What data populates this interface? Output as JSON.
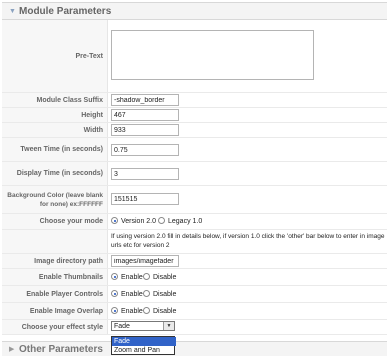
{
  "header": {
    "title": "Module Parameters",
    "expanded_icon": "▼"
  },
  "pretext": {
    "label": "Pre-Text",
    "value": ""
  },
  "module_class_suffix": {
    "label": "Module Class Suffix",
    "value": "-shadow_border"
  },
  "height": {
    "label": "Height",
    "value": "467"
  },
  "width": {
    "label": "Width",
    "value": "933"
  },
  "tween_time": {
    "label": "Tween Time (in seconds)",
    "value": "0.75"
  },
  "display_time": {
    "label": "Display Time (in seconds)",
    "value": "3"
  },
  "background_color": {
    "label": "Background Color (leave blank for none) ex:FFFFFF",
    "value": "151515"
  },
  "mode": {
    "label": "Choose your mode",
    "options": [
      "Version 2.0",
      "Legacy 1.0"
    ],
    "selected": "Version 2.0",
    "info": "If using version 2.0 fill in details below, if version 1.0 click the 'other' bar below to enter in image urls etc for version 2"
  },
  "image_directory": {
    "label": "Image directory path",
    "value": "images/imagefader"
  },
  "thumbnails": {
    "label": "Enable Thumbnails",
    "options": [
      "Enable",
      "Disable"
    ],
    "selected": "Enable"
  },
  "player_controls": {
    "label": "Enable Player Controls",
    "options": [
      "Enable",
      "Disable"
    ],
    "selected": "Enable"
  },
  "image_overlap": {
    "label": "Enable Image Overlap",
    "options": [
      "Enable",
      "Disable"
    ],
    "selected": "Enable"
  },
  "effect_style": {
    "label": "Choose your effect style",
    "value": "Fade",
    "options": [
      "Fade",
      "Zoom and Pan"
    ],
    "highlighted": "Fade"
  },
  "footer": {
    "title": "Other Parameters",
    "collapsed_icon": "▶"
  },
  "colors": {
    "header_bg": "#f4f4f4",
    "label_bg": "#f7f7f7",
    "selection": "#3163c8"
  }
}
